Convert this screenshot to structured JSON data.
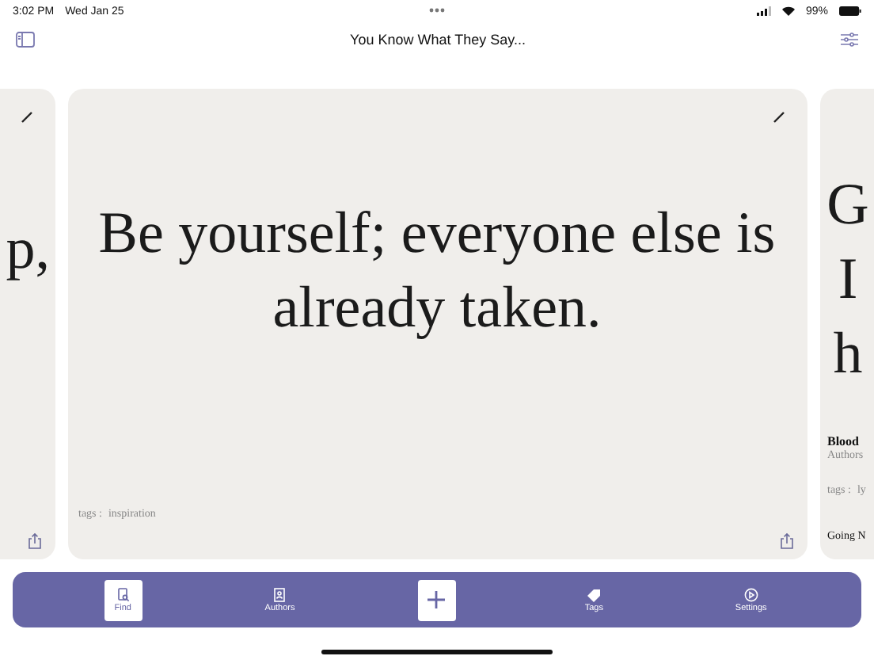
{
  "status_bar": {
    "time": "3:02 PM",
    "date": "Wed Jan 25",
    "battery": "99%"
  },
  "nav": {
    "title": "You Know What They Say..."
  },
  "cards": [
    {
      "kind": "side-left",
      "quote_lines": [
        "p,"
      ]
    },
    {
      "kind": "main",
      "quote_lines": [
        "Be yourself; everyone else is",
        "already taken."
      ],
      "tags_label": "tags :",
      "tags": [
        "inspiration"
      ]
    },
    {
      "kind": "side-right",
      "quote_lines": [
        "G",
        "I",
        "h"
      ],
      "author": "Blood",
      "source": "Authors",
      "tags_label": "tags :",
      "tags": [
        "ly"
      ],
      "footer": "Going N"
    }
  ],
  "tab_bar": [
    {
      "kind": "tab",
      "label": "Find",
      "selected": true
    },
    {
      "kind": "tab",
      "label": "Authors",
      "selected": false
    },
    {
      "kind": "add"
    },
    {
      "kind": "tab",
      "label": "Tags",
      "selected": false
    },
    {
      "kind": "tab",
      "label": "Settings",
      "selected": false
    }
  ]
}
